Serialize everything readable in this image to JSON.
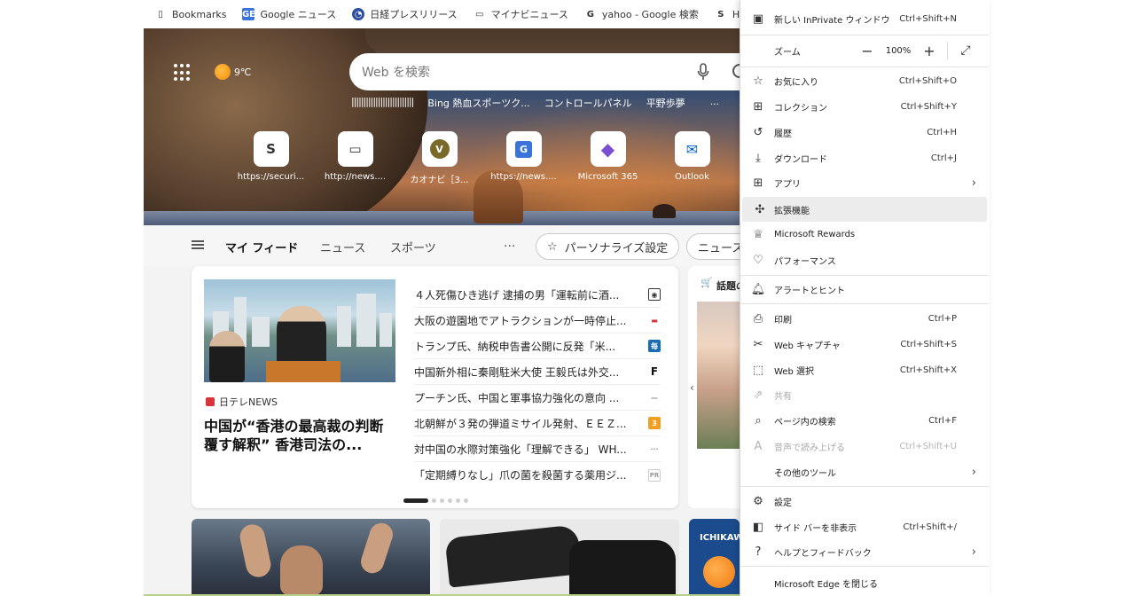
{
  "bookmarks": [
    {
      "label": "Bookmarks",
      "icon": "page-icon"
    },
    {
      "label": "Google ニュース",
      "icon": "google-news-icon"
    },
    {
      "label": "日経プレスリリース",
      "icon": "nikkei-icon"
    },
    {
      "label": "マイナビニュース",
      "icon": "monitor-icon"
    },
    {
      "label": "yahoo - Google 検索",
      "icon": "google-icon"
    },
    {
      "label": "Home - Security Bo...",
      "icon": "security-icon"
    }
  ],
  "weather": {
    "temp": "9℃"
  },
  "search": {
    "placeholder": "Web を検索"
  },
  "quick_links": [
    "||||||||||||||||||||||||||",
    "Bing 熱血スポーツク...",
    "コントロールパネル",
    "平野歩夢",
    "..."
  ],
  "tiles": [
    {
      "label": "https://securi...",
      "glyph": "S"
    },
    {
      "label": "http://news....",
      "glyph": "▭"
    },
    {
      "label": "カオナビ［3...",
      "glyph": "V"
    },
    {
      "label": "https://news....",
      "glyph": "G"
    },
    {
      "label": "Microsoft 365",
      "glyph": "◆"
    },
    {
      "label": "Outlook",
      "glyph": "✉"
    }
  ],
  "feed_nav": {
    "tabs": [
      "マイ フィード",
      "ニュース",
      "スポーツ"
    ],
    "more": "...",
    "personalize": "パーソナライズ設定",
    "news_pill": "ニュース"
  },
  "main_story": {
    "source": "日テレNEWS",
    "headline": "中国が“香港の最高裁の判断覆す解釈” 香港司法の..."
  },
  "news_list": [
    {
      "title": "４人死傷ひき逃げ 逮捕の男「運転前に酒...",
      "badge": "◉",
      "color": "#333333"
    },
    {
      "title": "大阪の遊園地でアトラクションが一時停止...",
      "badge": "▬",
      "color": "#d9343a"
    },
    {
      "title": "トランプ氏、納税申告書公開に反発「米...",
      "badge": "毎",
      "color": "#1a6db5"
    },
    {
      "title": "中国新外相に秦剛駐米大使 王毅氏は外交...",
      "badge": "F",
      "color": "#111111"
    },
    {
      "title": "プーチン氏、中国と軍事協力強化の意向 ...",
      "badge": "—",
      "color": "#888888"
    },
    {
      "title": "北朝鮮が３発の弾道ミサイル発射、ＥＥＺ...",
      "badge": "3",
      "color": "#f0a020"
    },
    {
      "title": "対中国の水際対策強化「理解できる」 WH...",
      "badge": "···",
      "color": "#999999"
    },
    {
      "title": "「定期縛りなし」爪の菌を殺菌する薬用ジ...",
      "badge": "PR",
      "color": "#999999"
    }
  ],
  "side_card": {
    "title": "話題の"
  },
  "bottom_tiles": {
    "third_label": "ICHIKAW"
  },
  "menu": {
    "items": [
      {
        "label": "新しい InPrivate ウィンドウ",
        "shortcut": "Ctrl+Shift+N",
        "icon": "inprivate-icon"
      },
      {
        "label": "ズーム",
        "zoom": "100%",
        "icon": ""
      },
      {
        "label": "お気に入り",
        "shortcut": "Ctrl+Shift+O",
        "icon": "favorites-icon"
      },
      {
        "label": "コレクション",
        "shortcut": "Ctrl+Shift+Y",
        "icon": "collections-icon"
      },
      {
        "label": "履歴",
        "shortcut": "Ctrl+H",
        "icon": "history-icon"
      },
      {
        "label": "ダウンロード",
        "shortcut": "Ctrl+J",
        "icon": "download-icon"
      },
      {
        "label": "アプリ",
        "icon": "apps-icon"
      },
      {
        "label": "拡張機能",
        "icon": "extensions-icon"
      },
      {
        "label": "Microsoft Rewards",
        "icon": "rewards-icon"
      },
      {
        "label": "パフォーマンス",
        "icon": "performance-icon"
      },
      {
        "label": "アラートとヒント",
        "icon": "bell-icon"
      },
      {
        "label": "印刷",
        "shortcut": "Ctrl+P",
        "icon": "print-icon"
      },
      {
        "label": "Web キャプチャ",
        "shortcut": "Ctrl+Shift+S",
        "icon": "capture-icon"
      },
      {
        "label": "Web 選択",
        "shortcut": "Ctrl+Shift+X",
        "icon": "select-icon"
      },
      {
        "label": "共有",
        "icon": "share-icon"
      },
      {
        "label": "ページ内の検索",
        "shortcut": "Ctrl+F",
        "icon": "find-icon"
      },
      {
        "label": "音声で読み上げる",
        "shortcut": "Ctrl+Shift+U",
        "icon": "read-aloud-icon"
      },
      {
        "label": "その他のツール",
        "icon": "tools-icon"
      },
      {
        "label": "設定",
        "icon": "settings-icon"
      },
      {
        "label": "サイド バーを非表示",
        "shortcut": "Ctrl+Shift+/",
        "icon": "sidebar-icon"
      },
      {
        "label": "ヘルプとフィードバック",
        "icon": "help-icon"
      },
      {
        "label": "Microsoft Edge を閉じる",
        "icon": ""
      }
    ]
  }
}
